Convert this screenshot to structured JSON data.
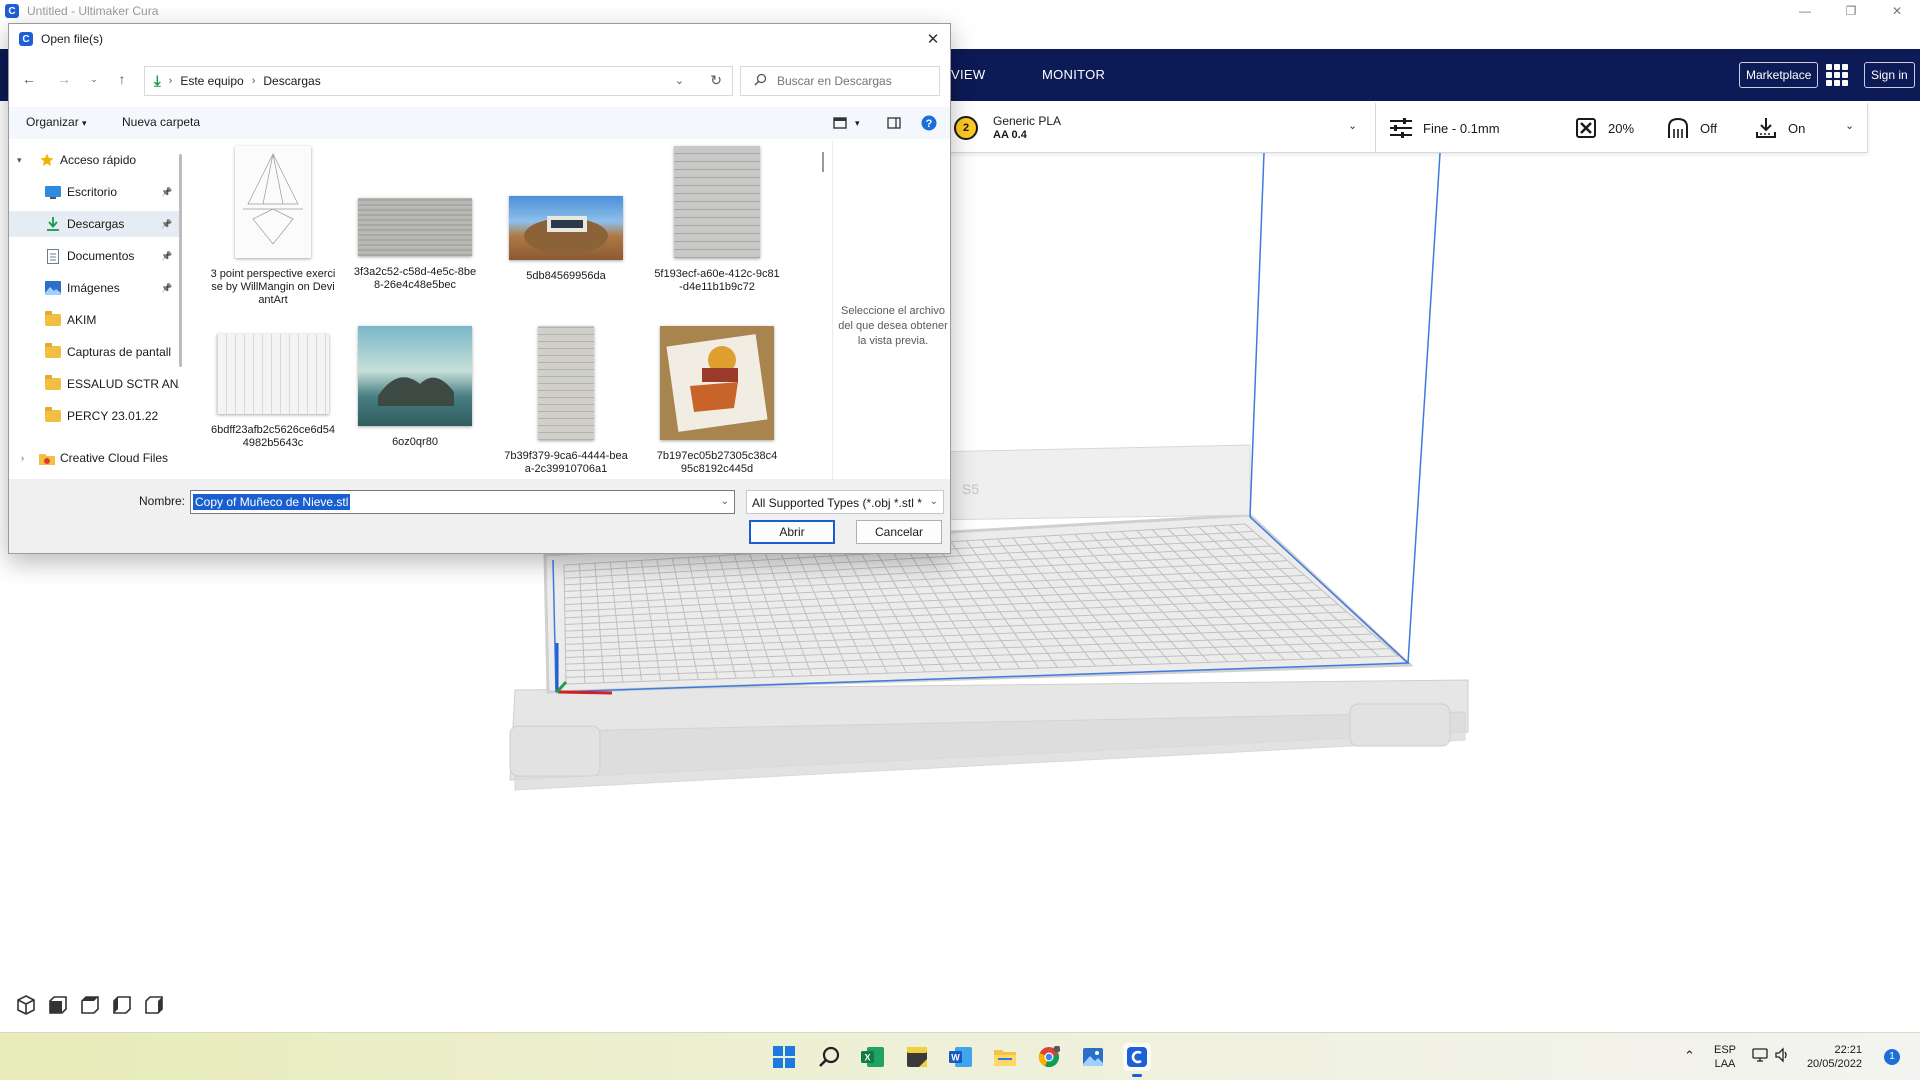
{
  "app": {
    "window_title": "Untitled - Ultimaker Cura",
    "app_icon": "C",
    "window_controls": [
      "—",
      "❐",
      "✕"
    ]
  },
  "header": {
    "tabs": [
      "VIEW",
      "MONITOR"
    ],
    "marketplace_label": "Marketplace",
    "signin_label": "Sign in",
    "bg_color": "#0c1a55"
  },
  "print_settings": {
    "extruder_number": "2",
    "material_name": "Generic PLA",
    "nozzle": "AA 0.4",
    "profile": "Fine - 0.1mm",
    "infill": "20%",
    "support": "Off",
    "adhesion": "On"
  },
  "viewport": {
    "printer_label": "S5",
    "camera_views": [
      "3d-view-icon",
      "front-view-icon",
      "top-view-icon",
      "left-view-icon",
      "right-view-icon"
    ]
  },
  "dialog": {
    "title": "Open file(s)",
    "breadcrumb": [
      "Este equipo",
      "Descargas"
    ],
    "search_placeholder": "Buscar en Descargas",
    "organize_label": "Organizar",
    "new_folder_label": "Nueva carpeta",
    "nav": [
      {
        "label": "Acceso rápido",
        "icon": "star-icon",
        "pinned": false,
        "expand": "▾"
      },
      {
        "label": "Escritorio",
        "icon": "desktop-icon",
        "pinned": true
      },
      {
        "label": "Descargas",
        "icon": "download-icon",
        "pinned": true,
        "selected": true
      },
      {
        "label": "Documentos",
        "icon": "documents-icon",
        "pinned": true
      },
      {
        "label": "Imágenes",
        "icon": "pictures-icon",
        "pinned": true
      },
      {
        "label": "AKIM",
        "icon": "folder-icon",
        "pinned": false
      },
      {
        "label": "Capturas de pantall",
        "icon": "folder-icon",
        "pinned": false
      },
      {
        "label": "ESSALUD SCTR ANA",
        "icon": "folder-icon",
        "pinned": false
      },
      {
        "label": "PERCY 23.01.22",
        "icon": "folder-icon",
        "pinned": false
      },
      {
        "label": "Creative Cloud Files",
        "icon": "creative-cloud-icon",
        "pinned": false,
        "expand": "›"
      }
    ],
    "files": [
      {
        "name": "3 point perspective exercise by WillMangin on DeviantArt"
      },
      {
        "name": "3f3a2c52-c58d-4e5c-8be8-26e4c48e5bec"
      },
      {
        "name": "5db84569956da"
      },
      {
        "name": "5f193ecf-a60e-412c-9c81-d4e11b1b9c72"
      },
      {
        "name": "6bdff23afb2c5626ce6d544982b5643c"
      },
      {
        "name": "6oz0qr80"
      },
      {
        "name": "7b39f379-9ca6-4444-beaa-2c39910706a1"
      },
      {
        "name": "7b197ec05b27305c38c495c8192c445d"
      }
    ],
    "preview_message": "Seleccione el archivo del que desea obtener la vista previa.",
    "filename_label": "Nombre:",
    "filename_value": "Copy of Muñeco de Nieve.stl",
    "filetype_value": "All Supported Types (*.obj *.stl *",
    "open_label": "Abrir",
    "cancel_label": "Cancelar"
  },
  "taskbar": {
    "apps": [
      "windows-start-icon",
      "search-icon",
      "excel-icon",
      "sticky-notes-icon",
      "word-icon",
      "file-explorer-icon",
      "chrome-icon",
      "photos-icon",
      "cura-icon"
    ],
    "language": "ESP",
    "layout": "LAA",
    "time": "22:21",
    "date": "20/05/2022",
    "notification_count": "1"
  }
}
